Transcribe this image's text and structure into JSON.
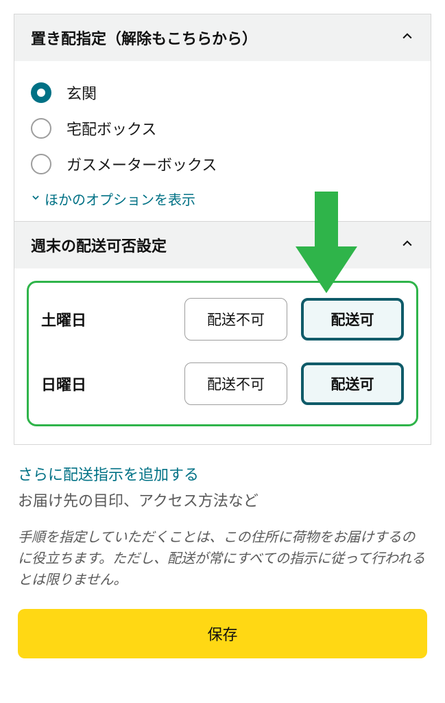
{
  "placement": {
    "title": "置き配指定（解除もこちらから）",
    "options": [
      {
        "label": "玄関",
        "checked": true
      },
      {
        "label": "宅配ボックス",
        "checked": false
      },
      {
        "label": "ガスメーターボックス",
        "checked": false
      }
    ],
    "more_label": "ほかのオプションを表示"
  },
  "weekend": {
    "title": "週末の配送可否設定",
    "days": [
      {
        "label": "土曜日",
        "no": "配送不可",
        "yes": "配送可",
        "selected": "yes"
      },
      {
        "label": "日曜日",
        "no": "配送不可",
        "yes": "配送可",
        "selected": "yes"
      }
    ]
  },
  "extra": {
    "add_link": "さらに配送指示を追加する",
    "add_sub": "お届け先の目印、アクセス方法など",
    "note": "手順を指定していただくことは、この住所に荷物をお届けするのに役立ちます。ただし、配送が常にすべての指示に従って行われるとは限りません。",
    "save_label": "保存"
  }
}
